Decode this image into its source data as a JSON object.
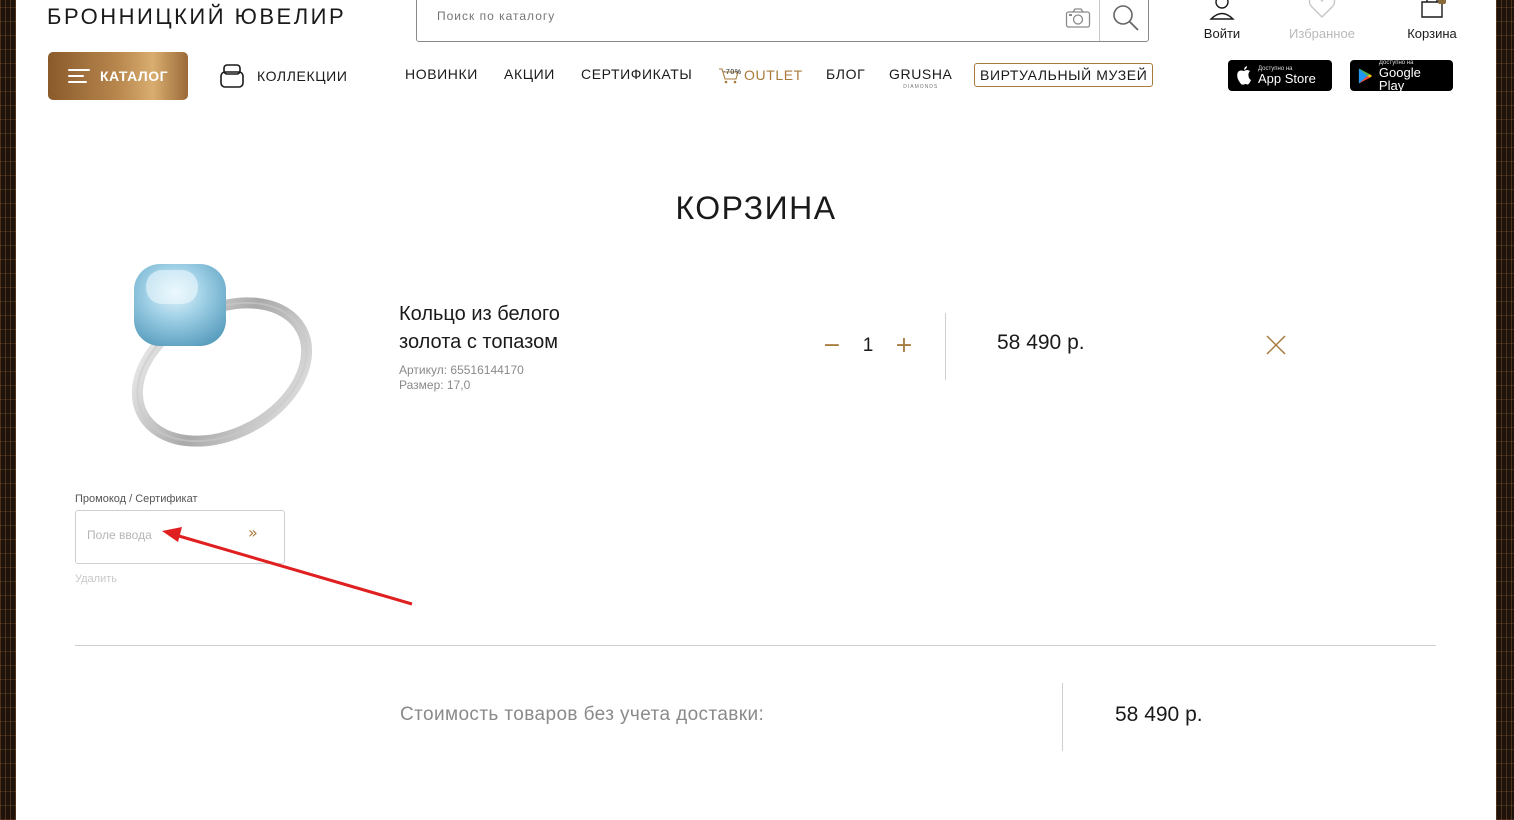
{
  "header": {
    "logo": "БРОННИЦКИЙ ЮВЕЛИР",
    "search_placeholder": "Поиск по каталогу",
    "login_label": "Войти",
    "favorites_label": "Избранное",
    "cart_label": "Корзина"
  },
  "nav": {
    "catalog": "КАТАЛОГ",
    "collections": "КОЛЛЕКЦИИ",
    "new": "НОВИНКИ",
    "sales": "АКЦИИ",
    "certificates": "СЕРТИФИКАТЫ",
    "outlet_badge": "-70%",
    "outlet": "OUTLET",
    "blog": "БЛОГ",
    "grusha": "GRUSHA",
    "grusha_sub": "DIAMONDS",
    "museum": "ВИРТУАЛЬНЫЙ МУЗЕЙ",
    "appstore_small": "Доступно на",
    "appstore": "App Store",
    "googleplay_small": "Доступно на",
    "googleplay": "Google Play"
  },
  "cart": {
    "title": "КОРЗИНА",
    "item": {
      "name": "Кольцо из белого золота с топазом",
      "article": "Артикул: 65516144170",
      "size": "Размер: 17,0",
      "qty_minus": "−",
      "quantity": "1",
      "qty_plus": "+",
      "price": "58 490 р."
    },
    "promo": {
      "label": "Промокод / Сертификат",
      "placeholder": "Поле ввода",
      "submit": "»",
      "delete": "Удалить"
    },
    "total_label": "Стоимость товаров без учета доставки:",
    "total_value": "58 490 р."
  },
  "colors": {
    "accent": "#a87a3c",
    "annotation_arrow": "#e02020"
  }
}
